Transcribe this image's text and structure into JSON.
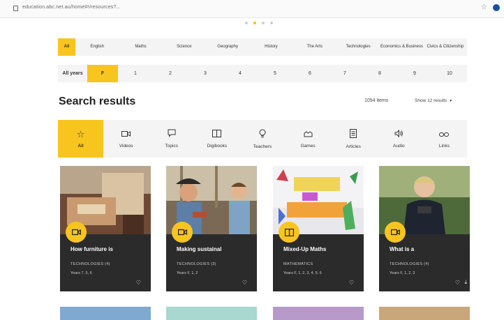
{
  "browser": {
    "url": "education.abc.net.au/home#!/resources?...",
    "star_icon": "star-icon",
    "profile_icon": "profile-icon"
  },
  "carousel": {
    "dots": 4,
    "active": 1
  },
  "subjects": [
    "All",
    "English",
    "Maths",
    "Science",
    "Geography",
    "History",
    "The Arts",
    "Technologies",
    "Economics & Business",
    "Civics & Citizenship"
  ],
  "years": {
    "label": "All years",
    "items": [
      "F",
      "1",
      "2",
      "3",
      "4",
      "5",
      "6",
      "7",
      "8",
      "9",
      "10"
    ],
    "selected": "F"
  },
  "search": {
    "title": "Search results",
    "count": "1054 items",
    "show": "Show 12 results"
  },
  "types": [
    {
      "label": "All",
      "icon": "☆",
      "name": "star-icon"
    },
    {
      "label": "Videos",
      "icon": "▭",
      "name": "video-icon"
    },
    {
      "label": "Topics",
      "icon": "◯",
      "name": "speech-bubble-icon"
    },
    {
      "label": "Digibooks",
      "icon": "▢",
      "name": "book-icon"
    },
    {
      "label": "Teachers",
      "icon": "⚲",
      "name": "lightbulb-icon"
    },
    {
      "label": "Games",
      "icon": "♜",
      "name": "game-icon"
    },
    {
      "label": "Articles",
      "icon": "▤",
      "name": "article-icon"
    },
    {
      "label": "Audio",
      "icon": "◁)",
      "name": "audio-icon"
    },
    {
      "label": "Links",
      "icon": "∞",
      "name": "link-icon"
    }
  ],
  "cards": [
    {
      "title": "How furniture is",
      "subject": "TECHNOLOGIES (4)",
      "years": "Years 7, 5, 6",
      "icon": "video-icon"
    },
    {
      "title": "Making sustainal",
      "subject": "TECHNOLOGIES (3)",
      "years": "Years F, 1, 2",
      "icon": "video-icon"
    },
    {
      "title": "Mixed-Up Maths",
      "subject": "MATHEMATICS",
      "years": "Years F, 1, 2, 3, 4, 5, 6",
      "icon": "book-icon"
    },
    {
      "title": "What is a",
      "subject": "TECHNOLOGIES (4)",
      "years": "Years F, 1, 2, 3",
      "icon": "video-icon"
    }
  ],
  "colors": {
    "accent": "#f7c51e",
    "card_bg": "#2b2b2b",
    "filter_bg": "#f4f4f4"
  }
}
